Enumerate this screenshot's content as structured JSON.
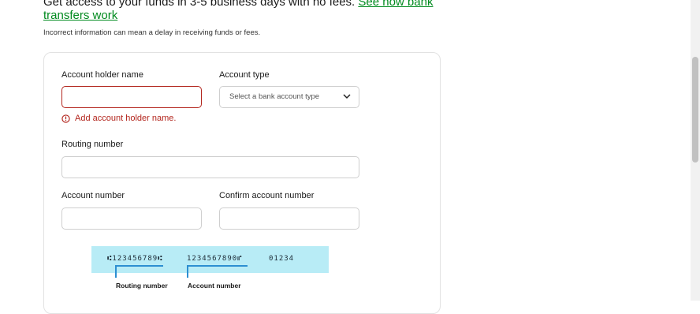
{
  "intro": {
    "text": "Get access to your funds in 3-5 business days with no fees. ",
    "link": "See how bank transfers work"
  },
  "note": "Incorrect information can mean a delay in receiving funds or fees.",
  "form": {
    "account_holder_label": "Account holder name",
    "account_holder_value": "",
    "account_holder_error": "Add account holder name.",
    "account_type_label": "Account type",
    "account_type_placeholder": "Select a bank account type",
    "routing_label": "Routing number",
    "routing_value": "",
    "account_number_label": "Account number",
    "account_number_value": "",
    "confirm_label": "Confirm account number",
    "confirm_value": ""
  },
  "check": {
    "routing_micr": "⑆123456789⑆",
    "account_micr": "1234567890⑈",
    "check_micr": "01234",
    "routing_caption": "Routing number",
    "account_caption": "Account number"
  },
  "colors": {
    "error": "#b3261e",
    "link": "#008a1e",
    "check_bg": "#b8ecf6",
    "bracket": "#2d8fd1"
  }
}
